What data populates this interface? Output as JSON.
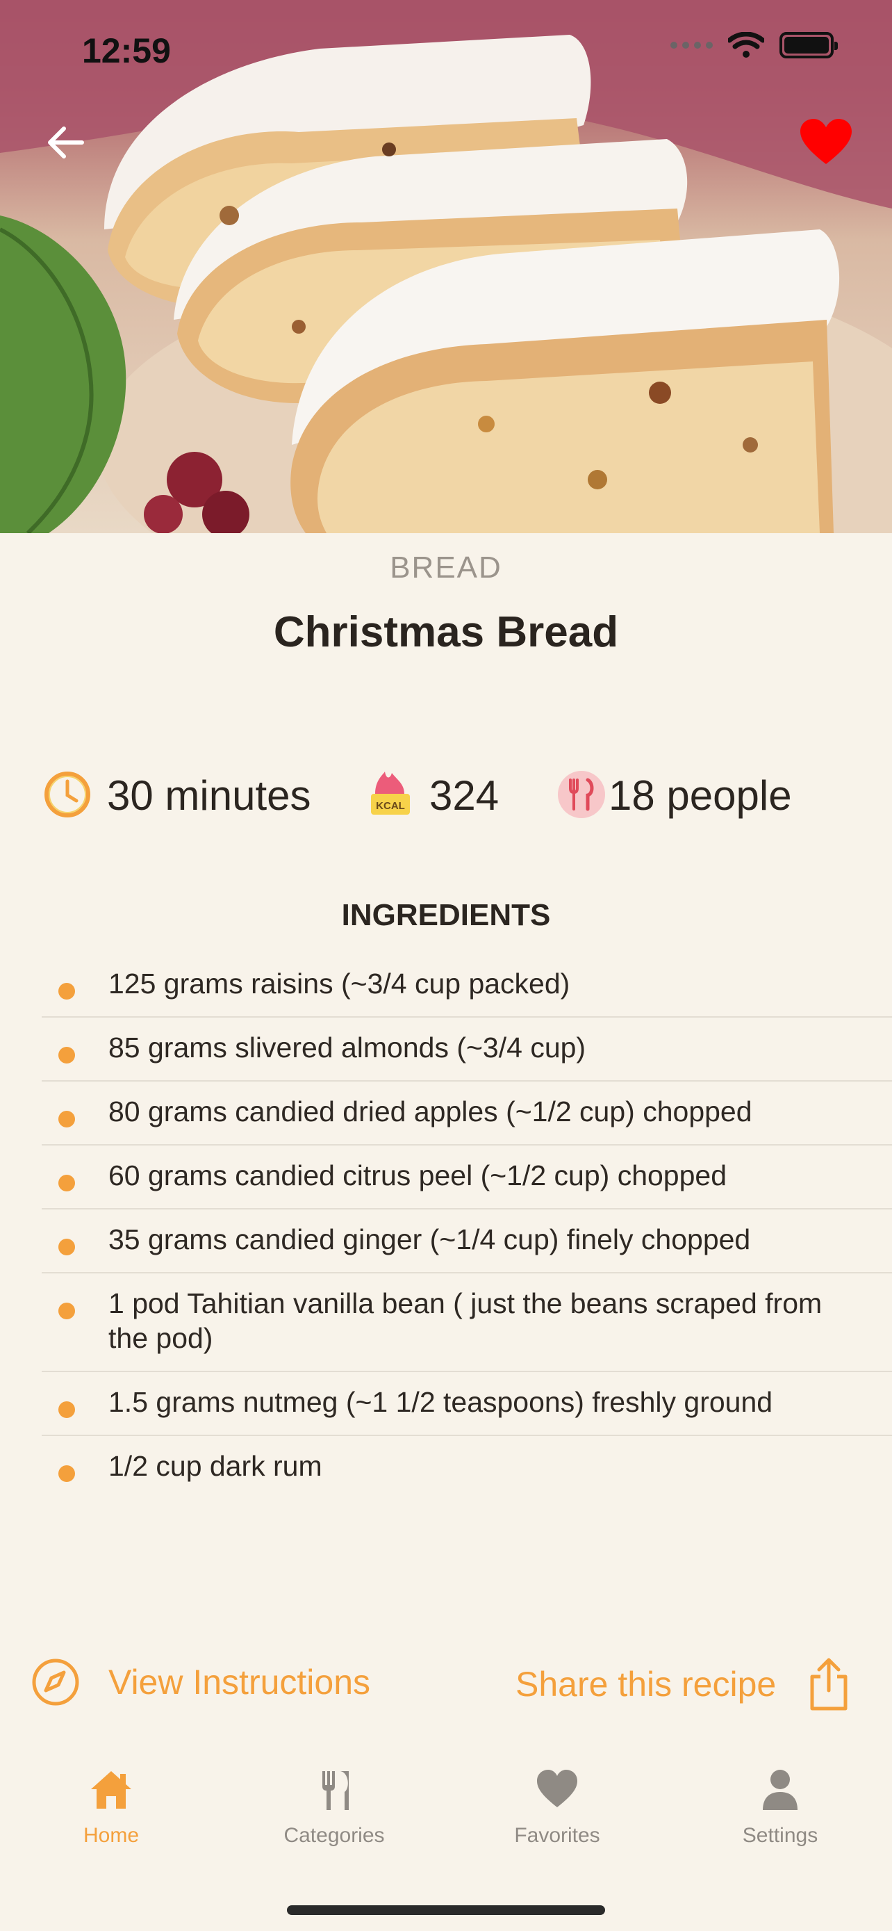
{
  "status_bar": {
    "time": "12:59"
  },
  "recipe": {
    "category": "BREAD",
    "title": "Christmas Bread",
    "duration": "30 minutes",
    "calories": "324",
    "calories_badge": "KCAL",
    "servings": "18 people"
  },
  "ingredients": {
    "header": "INGREDIENTS",
    "items": [
      "125 grams raisins (~3/4 cup packed)",
      "85 grams slivered almonds (~3/4 cup)",
      "80 grams candied dried apples (~1/2 cup) chopped",
      "60 grams candied citrus peel (~1/2 cup) chopped",
      "35 grams candied ginger (~1/4 cup) finely chopped",
      "1 pod Tahitian vanilla bean ( just the beans scraped from the pod)",
      "1.5 grams nutmeg (~1 1/2 teaspoons) freshly ground",
      "1/2 cup dark rum"
    ]
  },
  "actions": {
    "view_instructions": "View Instructions",
    "share": "Share this recipe"
  },
  "tabs": [
    {
      "label": "Home",
      "icon": "home-icon",
      "active": true
    },
    {
      "label": "Categories",
      "icon": "fork-knife-icon",
      "active": false
    },
    {
      "label": "Favorites",
      "icon": "heart-icon",
      "active": false
    },
    {
      "label": "Settings",
      "icon": "person-icon",
      "active": false
    }
  ],
  "colors": {
    "accent": "#f4a03c",
    "favorite": "#ff0000",
    "background": "#f8f3ea"
  }
}
